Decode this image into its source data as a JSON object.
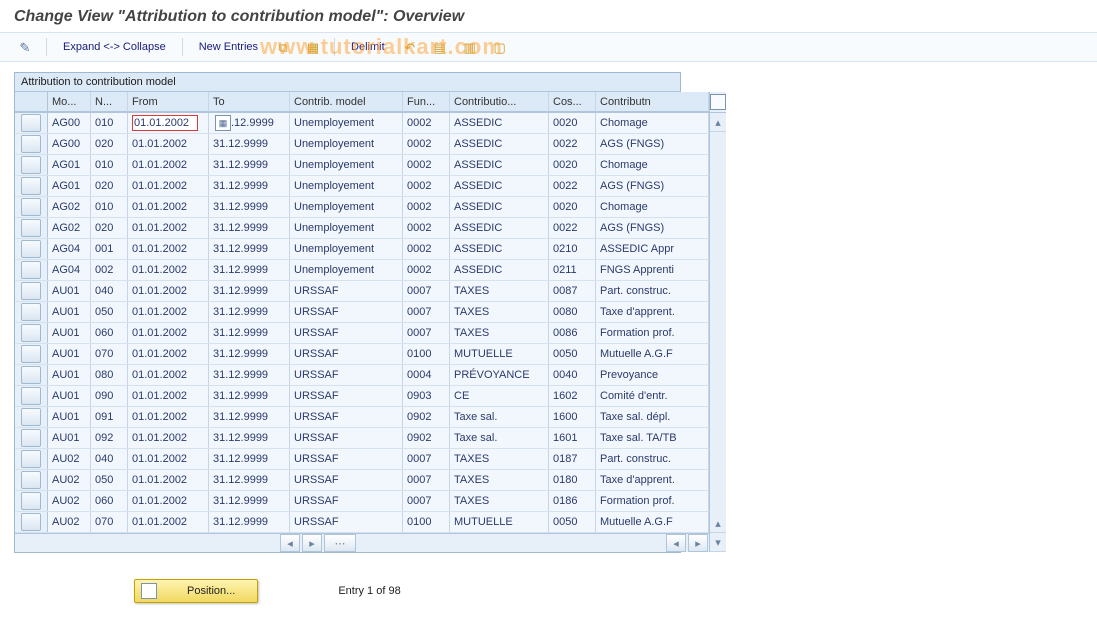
{
  "title": "Change View \"Attribution to contribution model\": Overview",
  "watermark": "www.tutorialkart.com",
  "toolbar": {
    "expand": "Expand <-> Collapse",
    "newEntries": "New Entries",
    "delimit": "Delimit"
  },
  "grid": {
    "title": "Attribution to contribution model",
    "headers": {
      "mo": "Mo...",
      "n": "N...",
      "from": "From",
      "to": "To",
      "cm": "Contrib. model",
      "fun": "Fun...",
      "co": "Contributio...",
      "cos": "Cos...",
      "cn": "Contributn"
    },
    "rows": [
      {
        "mo": "AG00",
        "n": "010",
        "from": "01.01.2002",
        "to": ".12.9999",
        "cm": "Unemployement",
        "fun": "0002",
        "co": "ASSEDIC",
        "cos": "0020",
        "cn": "Chomage",
        "edit": true
      },
      {
        "mo": "AG00",
        "n": "020",
        "from": "01.01.2002",
        "to": "31.12.9999",
        "cm": "Unemployement",
        "fun": "0002",
        "co": "ASSEDIC",
        "cos": "0022",
        "cn": "AGS (FNGS)"
      },
      {
        "mo": "AG01",
        "n": "010",
        "from": "01.01.2002",
        "to": "31.12.9999",
        "cm": "Unemployement",
        "fun": "0002",
        "co": "ASSEDIC",
        "cos": "0020",
        "cn": "Chomage"
      },
      {
        "mo": "AG01",
        "n": "020",
        "from": "01.01.2002",
        "to": "31.12.9999",
        "cm": "Unemployement",
        "fun": "0002",
        "co": "ASSEDIC",
        "cos": "0022",
        "cn": "AGS (FNGS)"
      },
      {
        "mo": "AG02",
        "n": "010",
        "from": "01.01.2002",
        "to": "31.12.9999",
        "cm": "Unemployement",
        "fun": "0002",
        "co": "ASSEDIC",
        "cos": "0020",
        "cn": "Chomage"
      },
      {
        "mo": "AG02",
        "n": "020",
        "from": "01.01.2002",
        "to": "31.12.9999",
        "cm": "Unemployement",
        "fun": "0002",
        "co": "ASSEDIC",
        "cos": "0022",
        "cn": "AGS (FNGS)"
      },
      {
        "mo": "AG04",
        "n": "001",
        "from": "01.01.2002",
        "to": "31.12.9999",
        "cm": "Unemployement",
        "fun": "0002",
        "co": "ASSEDIC",
        "cos": "0210",
        "cn": "ASSEDIC Appr"
      },
      {
        "mo": "AG04",
        "n": "002",
        "from": "01.01.2002",
        "to": "31.12.9999",
        "cm": "Unemployement",
        "fun": "0002",
        "co": "ASSEDIC",
        "cos": "0211",
        "cn": "FNGS Apprenti"
      },
      {
        "mo": "AU01",
        "n": "040",
        "from": "01.01.2002",
        "to": "31.12.9999",
        "cm": "URSSAF",
        "fun": "0007",
        "co": "TAXES",
        "cos": "0087",
        "cn": "Part. construc."
      },
      {
        "mo": "AU01",
        "n": "050",
        "from": "01.01.2002",
        "to": "31.12.9999",
        "cm": "URSSAF",
        "fun": "0007",
        "co": "TAXES",
        "cos": "0080",
        "cn": "Taxe d'apprent."
      },
      {
        "mo": "AU01",
        "n": "060",
        "from": "01.01.2002",
        "to": "31.12.9999",
        "cm": "URSSAF",
        "fun": "0007",
        "co": "TAXES",
        "cos": "0086",
        "cn": "Formation prof."
      },
      {
        "mo": "AU01",
        "n": "070",
        "from": "01.01.2002",
        "to": "31.12.9999",
        "cm": "URSSAF",
        "fun": "0100",
        "co": "MUTUELLE",
        "cos": "0050",
        "cn": "Mutuelle A.G.F"
      },
      {
        "mo": "AU01",
        "n": "080",
        "from": "01.01.2002",
        "to": "31.12.9999",
        "cm": "URSSAF",
        "fun": "0004",
        "co": "PRÉVOYANCE",
        "cos": "0040",
        "cn": "Prevoyance"
      },
      {
        "mo": "AU01",
        "n": "090",
        "from": "01.01.2002",
        "to": "31.12.9999",
        "cm": "URSSAF",
        "fun": "0903",
        "co": "CE",
        "cos": "1602",
        "cn": "Comité d'entr."
      },
      {
        "mo": "AU01",
        "n": "091",
        "from": "01.01.2002",
        "to": "31.12.9999",
        "cm": "URSSAF",
        "fun": "0902",
        "co": "Taxe sal.",
        "cos": "1600",
        "cn": "Taxe sal. dépl."
      },
      {
        "mo": "AU01",
        "n": "092",
        "from": "01.01.2002",
        "to": "31.12.9999",
        "cm": "URSSAF",
        "fun": "0902",
        "co": "Taxe sal.",
        "cos": "1601",
        "cn": "Taxe sal. TA/TB"
      },
      {
        "mo": "AU02",
        "n": "040",
        "from": "01.01.2002",
        "to": "31.12.9999",
        "cm": "URSSAF",
        "fun": "0007",
        "co": "TAXES",
        "cos": "0187",
        "cn": "Part. construc."
      },
      {
        "mo": "AU02",
        "n": "050",
        "from": "01.01.2002",
        "to": "31.12.9999",
        "cm": "URSSAF",
        "fun": "0007",
        "co": "TAXES",
        "cos": "0180",
        "cn": "Taxe d'apprent."
      },
      {
        "mo": "AU02",
        "n": "060",
        "from": "01.01.2002",
        "to": "31.12.9999",
        "cm": "URSSAF",
        "fun": "0007",
        "co": "TAXES",
        "cos": "0186",
        "cn": "Formation prof."
      },
      {
        "mo": "AU02",
        "n": "070",
        "from": "01.01.2002",
        "to": "31.12.9999",
        "cm": "URSSAF",
        "fun": "0100",
        "co": "MUTUELLE",
        "cos": "0050",
        "cn": "Mutuelle A.G.F"
      }
    ]
  },
  "footer": {
    "position": "Position...",
    "entry": "Entry 1 of 98"
  }
}
